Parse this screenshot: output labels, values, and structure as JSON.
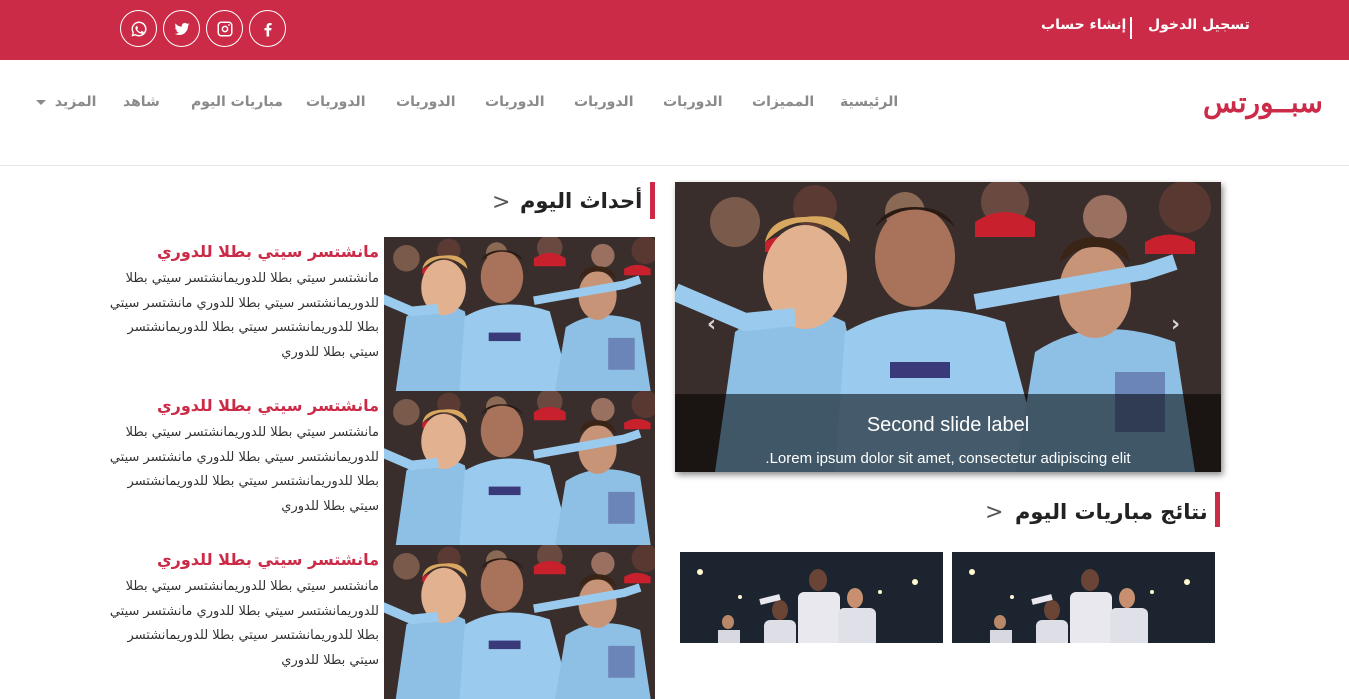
{
  "topbar": {
    "login": "تسجيل الدخول",
    "register": "إنشاء حساب",
    "social_icons": [
      "whatsapp-icon",
      "twitter-icon",
      "instagram-icon",
      "facebook-icon"
    ]
  },
  "navbar": {
    "logo": "سبــورتس",
    "items": [
      "الرئيسية",
      "المميزات",
      "الدوريات",
      "الدوريات",
      "الدوريات",
      "الدوريات",
      "الدوريات",
      "مباريات اليوم",
      "شاهد"
    ],
    "more": "المزيد"
  },
  "carousel": {
    "caption_title": "Second slide label",
    "caption_text": ".Lorem ipsum dolor sit amet, consectetur adipiscing elit",
    "prev": "‹",
    "next": "›"
  },
  "today_events": {
    "heading": "أحداث اليوم",
    "chevron": ">",
    "items": [
      {
        "title": "مانشتسر سيتي بطلا للدوري",
        "body": "مانشتسر سيتي بطلا للدوريمانشتسر سيتي بطلا للدوريمانشتسر سيتي بطلا للدوري مانشتسر سيتي بطلا للدوريمانشتسر سيتي بطلا للدوريمانشتسر سيتي بطلا للدوري"
      },
      {
        "title": "مانشتسر سيتي بطلا للدوري",
        "body": "مانشتسر سيتي بطلا للدوريمانشتسر سيتي بطلا للدوريمانشتسر سيتي بطلا للدوري مانشتسر سيتي بطلا للدوريمانشتسر سيتي بطلا للدوريمانشتسر سيتي بطلا للدوري"
      },
      {
        "title": "مانشتسر سيتي بطلا للدوري",
        "body": "مانشتسر سيتي بطلا للدوريمانشتسر سيتي بطلا للدوريمانشتسر سيتي بطلا للدوري مانشتسر سيتي بطلا للدوريمانشتسر سيتي بطلا للدوريمانشتسر سيتي بطلا للدوري"
      }
    ]
  },
  "match_results": {
    "heading": "نتائج مباريات اليوم",
    "chevron": ">"
  },
  "colors": {
    "brand": "#cc2b48",
    "nav_text": "#8a8a8a"
  }
}
